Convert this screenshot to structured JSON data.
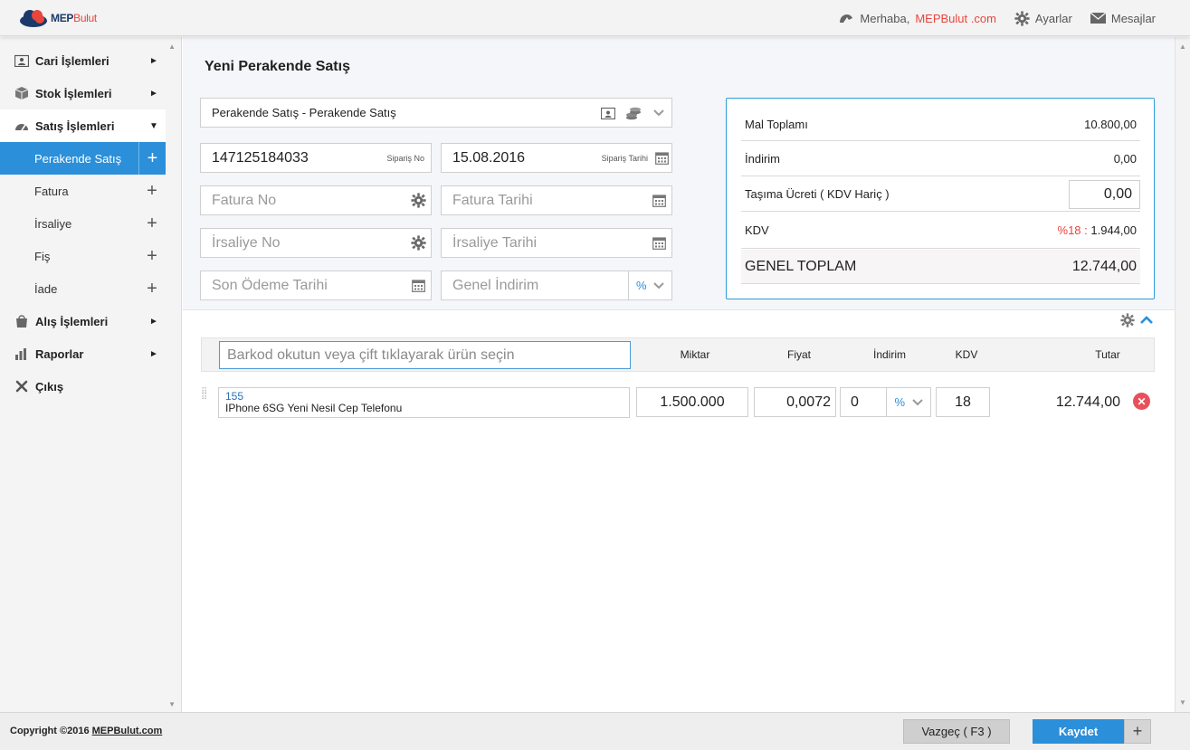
{
  "header": {
    "logo_main": "MEP",
    "logo_sub": "Bulut",
    "greeting": "Merhaba,",
    "user": "MEPBulut .com",
    "settings": "Ayarlar",
    "messages": "Mesajlar"
  },
  "sidebar": {
    "cari": "Cari İşlemleri",
    "stok": "Stok İşlemleri",
    "satis": "Satış İşlemleri",
    "sub": {
      "perakende": "Perakende Satış",
      "fatura": "Fatura",
      "irsaliye": "İrsaliye",
      "fis": "Fiş",
      "iade": "İade"
    },
    "alis": "Alış İşlemleri",
    "raporlar": "Raporlar",
    "cikis": "Çıkış"
  },
  "form": {
    "title": "Yeni Perakende Satış",
    "sale_type": "Perakende Satış - Perakende Satış",
    "order_no": "147125184033",
    "order_no_label": "Sipariş No",
    "order_date": "15.08.2016",
    "order_date_label": "Sipariş Tarihi",
    "invoice_no_ph": "Fatura No",
    "invoice_date_ph": "Fatura Tarihi",
    "waybill_no_ph": "İrsaliye No",
    "waybill_date_ph": "İrsaliye Tarihi",
    "due_date_ph": "Son Ödeme Tarihi",
    "general_discount_ph": "Genel İndirim",
    "discount_type": "%"
  },
  "summary": {
    "goods_total_label": "Mal Toplamı",
    "goods_total": "10.800,00",
    "discount_label": "İndirim",
    "discount": "0,00",
    "shipping_label": "Taşıma Ücreti ( KDV Hariç )",
    "shipping": "0,00",
    "vat_label": "KDV",
    "vat_rate": "%18 :",
    "vat": "1.944,00",
    "grand_total_label": "GENEL TOPLAM",
    "grand_total": "12.744,00"
  },
  "table": {
    "barcode_ph": "Barkod okutun veya çift tıklayarak ürün seçin",
    "col_qty": "Miktar",
    "col_price": "Fiyat",
    "col_discount": "İndirim",
    "col_vat": "KDV",
    "col_total": "Tutar",
    "row": {
      "code": "155",
      "name": "IPhone 6SG Yeni Nesil Cep Telefonu",
      "qty": "1.500.000",
      "price": "0,0072",
      "discount": "0",
      "discount_type": "%",
      "vat": "18",
      "total": "12.744,00"
    }
  },
  "footer": {
    "copyright": "Copyright ©2016",
    "copyright_link": "MEPBulut.com",
    "cancel": "Vazgeç ( F3 )",
    "save": "Kaydet",
    "plus": "+"
  },
  "colors": {
    "accent": "#2b8fd9",
    "brand_red": "#e8453c",
    "panel_border": "#2b9fd9"
  }
}
